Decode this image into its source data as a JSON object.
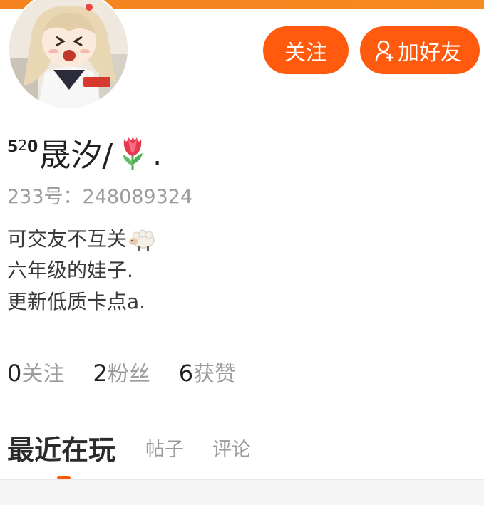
{
  "colors": {
    "accent": "#ff5a0d",
    "top_bar": "#f58a1f"
  },
  "header": {
    "follow_label": "关注",
    "add_friend_label": "加好友",
    "add_friend_icon": "user-add-icon"
  },
  "profile": {
    "name_prefix_a": "5",
    "name_prefix_b": "2",
    "name_prefix_c": "0",
    "name": "晟汐/",
    "name_emoji": "tulip-emoji",
    "name_suffix": ".",
    "uid": "233号：248089324",
    "bio": [
      {
        "text": "可交友不互关",
        "emoji": "sheep-emoji"
      },
      {
        "text": "六年级的娃子."
      },
      {
        "text": "更新低质卡点a."
      }
    ]
  },
  "stats": [
    {
      "num": "0",
      "label": "关注"
    },
    {
      "num": "2",
      "label": "粉丝"
    },
    {
      "num": "6",
      "label": "获赞"
    }
  ],
  "tabs": [
    {
      "label": "最近在玩",
      "active": true
    },
    {
      "label": "帖子"
    },
    {
      "label": "评论"
    }
  ]
}
